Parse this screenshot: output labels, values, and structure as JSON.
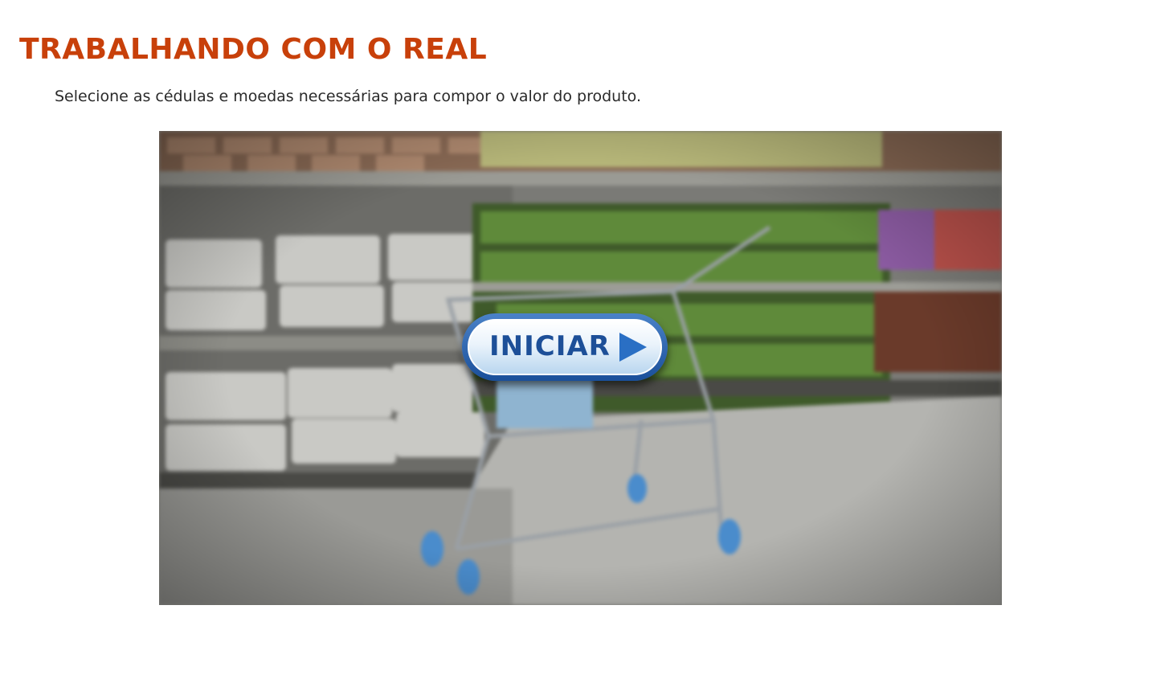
{
  "header": {
    "title": "TRABALHANDO COM O REAL",
    "instructions": "Selecione as cédulas e moedas necessárias para compor o valor do produto."
  },
  "game": {
    "background_scene": "supermarket-aisle-with-shopping-cart",
    "start_button": {
      "label": "INICIAR",
      "icon": "play-arrow-icon"
    }
  },
  "colors": {
    "title": "#c8400a",
    "button_text": "#1d4f98",
    "button_border": "#2a5fae"
  }
}
